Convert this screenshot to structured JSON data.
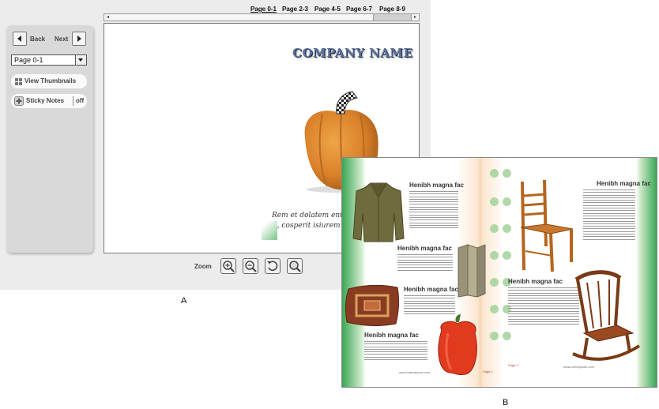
{
  "viewer": {
    "tabs": [
      "Page 0-1",
      "Page 2-3",
      "Page 4-5",
      "Page 6-7",
      "Page 8-9"
    ],
    "active_tab": "Page 0-1",
    "back_label": "Back",
    "next_label": "Next",
    "page_select_value": "Page 0-1",
    "view_thumbnails_label": "View Thumbnails",
    "sticky_notes_label": "Sticky Notes",
    "sticky_notes_state": "off",
    "zoom_label": "Zoom",
    "cover_title": "COMPANY NAME",
    "cover_script_line1": "Rem et dolatem ent i",
    "cover_script_line2": "ea, cosperit isiurem dile"
  },
  "spread": {
    "heading_1": "Henibh magna fac",
    "heading_2": "Henibh magna fac",
    "heading_3": "Henibh magna fac",
    "heading_4": "Henibh magna fac",
    "heading_5": "Henibh magna fac",
    "heading_6": "Henibh magna fac",
    "url_left": "www.loremipsum.com",
    "url_right": "www.loremipsum.com",
    "page_left": "Page 1",
    "page_right": "Page 2"
  },
  "captions": {
    "a": "A",
    "b": "B"
  },
  "colors": {
    "background": "#ececec",
    "sidebar": "#d9d9d9",
    "accent_green": "#3aa655",
    "pumpkin": "#d98a2e",
    "pepper": "#e23a1f"
  }
}
